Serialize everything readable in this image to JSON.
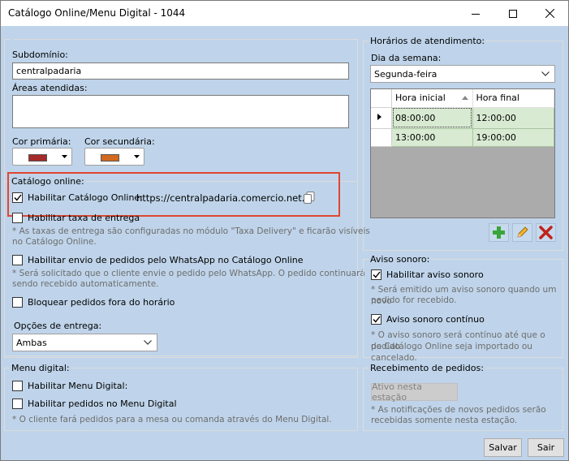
{
  "window": {
    "title": "Catálogo Online/Menu Digital - 1044",
    "minimize_icon": "minimize-icon",
    "maximize_icon": "maximize-icon",
    "close_icon": "close-icon"
  },
  "general": {
    "subdomain_label": "Subdomínio:",
    "subdomain_value": "centralpadaria",
    "areas_label": "Áreas atendidas:",
    "areas_value": "",
    "primary_color_label": "Cor primária:",
    "primary_color": "#a52a2a",
    "secondary_color_label": "Cor secundária:",
    "secondary_color": "#d2691e"
  },
  "catalog": {
    "legend": "Catálogo online:",
    "enable_label": "Habilitar Catálogo Online:",
    "enable_checked": true,
    "url": "https://centralpadaria.comercio.net.br",
    "copy_icon": "copy-icon",
    "delivery_fee_label": "Habilitar taxa de entrega",
    "delivery_fee_checked": false,
    "delivery_fee_note_1": "* As taxas de entrega são configuradas no módulo \"Taxa Delivery\" e ficarão visíveis",
    "delivery_fee_note_2": "no Catálogo Online.",
    "whatsapp_label": "Habilitar envio de pedidos pelo WhatsApp no Catálogo Online",
    "whatsapp_checked": false,
    "whatsapp_note_1": "* Será solicitado que o cliente envie o pedido pelo WhatsApp. O pedido continuará",
    "whatsapp_note_2": "sendo recebido automaticamente.",
    "block_orders_label": "Bloquear pedidos fora do horário",
    "block_orders_checked": false,
    "delivery_options_label": "Opções de entrega:",
    "delivery_options_value": "Ambas"
  },
  "menu_digital": {
    "legend": "Menu digital:",
    "enable_label": "Habilitar Menu Digital:",
    "enable_checked": false,
    "orders_label": "Habilitar pedidos no Menu Digital",
    "orders_checked": false,
    "note": "* O cliente fará pedidos para a mesa ou comanda através do Menu Digital."
  },
  "schedule": {
    "legend": "Horários de atendimento:",
    "weekday_label": "Dia da semana:",
    "weekday_value": "Segunda-feira",
    "columns": [
      "Hora inicial",
      "Hora final"
    ],
    "rows": [
      [
        "08:00:00",
        "12:00:00"
      ],
      [
        "13:00:00",
        "19:00:00"
      ]
    ],
    "add_icon": "add-icon",
    "edit_icon": "edit-pencil-icon",
    "delete_icon": "delete-icon"
  },
  "sound": {
    "legend": "Aviso sonoro:",
    "enable_label": "Habilitar aviso sonoro",
    "enable_checked": true,
    "enable_note_1": "* Será emitido um aviso sonoro quando um novo",
    "enable_note_2": "pedido for recebido.",
    "continuous_label": "Aviso sonoro contínuo",
    "continuous_checked": true,
    "continuous_note_1": "* O aviso sonoro será contínuo até que o pedido",
    "continuous_note_2": "do Catálogo Online seja importado ou cancelado."
  },
  "receiving": {
    "legend": "Recebimento de pedidos:",
    "station_button": "Ativo nesta estação",
    "note_1": "* As notificações de novos pedidos serão",
    "note_2": "recebidas somente nesta estação."
  },
  "footer": {
    "save_label": "Salvar",
    "exit_label": "Sair"
  }
}
